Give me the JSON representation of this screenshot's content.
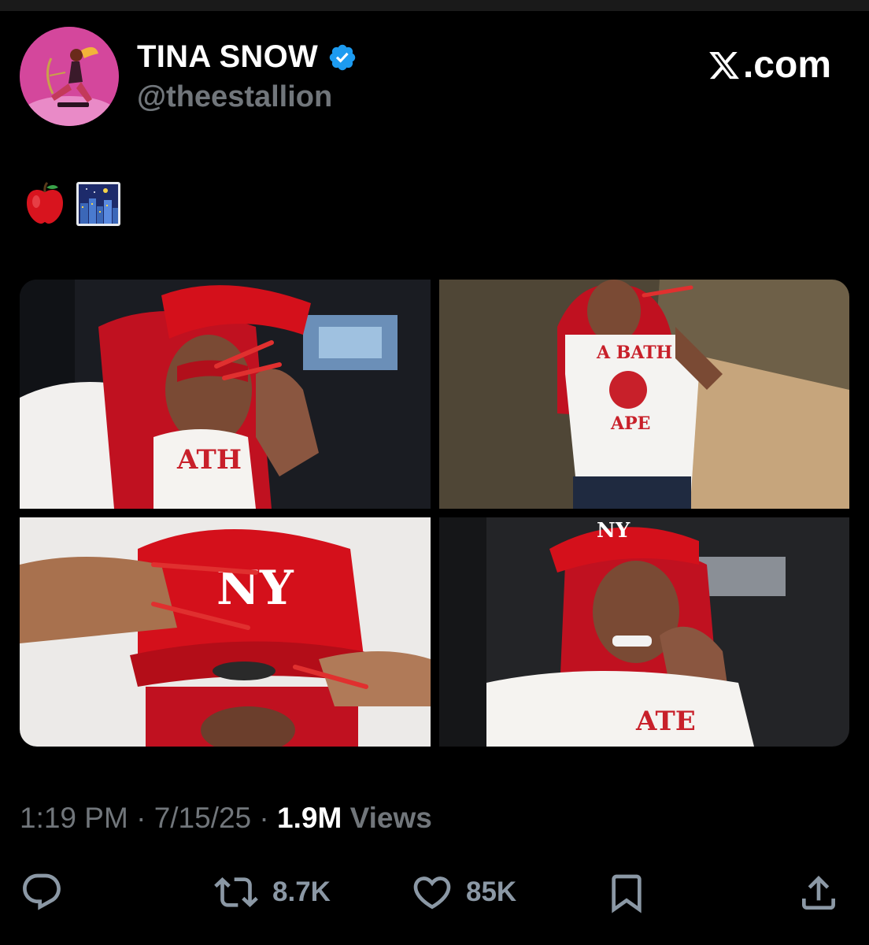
{
  "header": {
    "display_name": "TINA SNOW",
    "handle": "@theestallion",
    "verified": true,
    "site_label": "com"
  },
  "tweet": {
    "text_emojis": [
      "🍎",
      "🌃"
    ]
  },
  "media": [
    {
      "name": "photo-car-selfie-cap"
    },
    {
      "name": "photo-standing-white-tee"
    },
    {
      "name": "photo-closeup-red-cap"
    },
    {
      "name": "photo-car-selfie-smile"
    }
  ],
  "meta": {
    "time": "1:19 PM",
    "date": "7/15/25",
    "views_count": "1.9M",
    "views_label": "Views"
  },
  "actions": {
    "reply_count": "",
    "retweet_count": "8.7K",
    "like_count": "85K"
  },
  "colors": {
    "background": "#000000",
    "muted": "#71767b",
    "verified": "#1d9bf0",
    "cap_red": "#d4101b"
  }
}
